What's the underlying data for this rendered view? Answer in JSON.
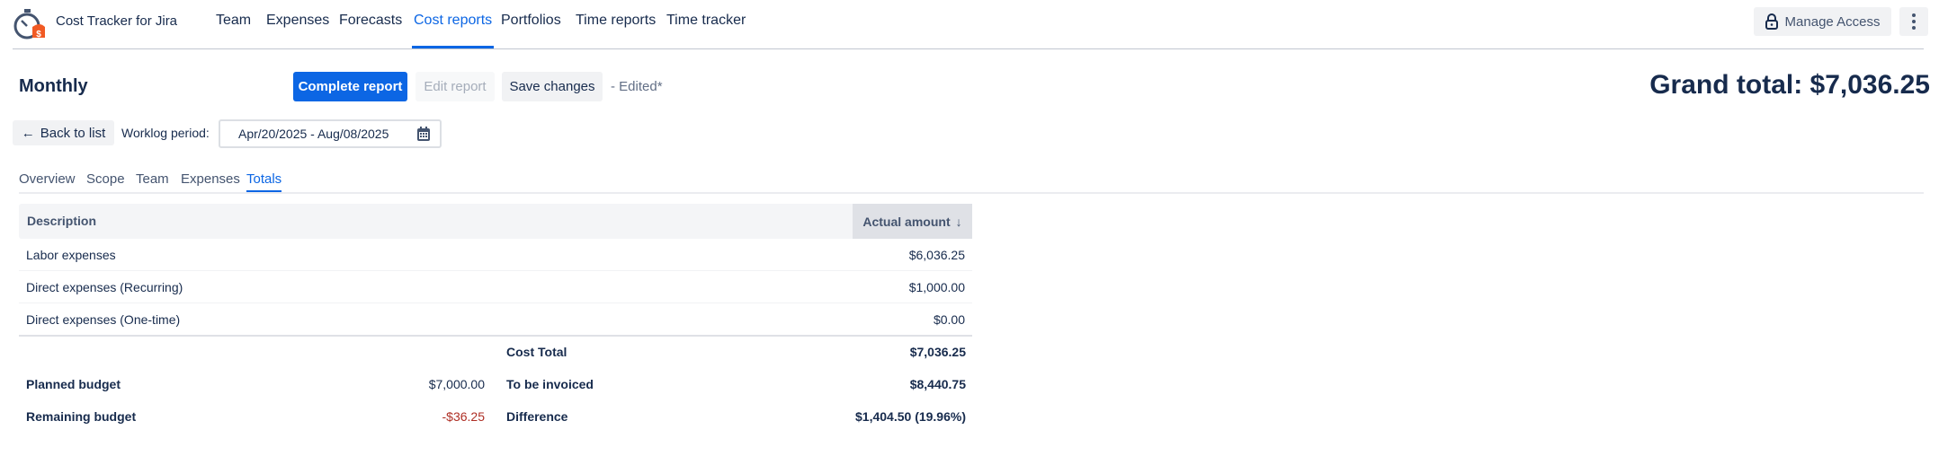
{
  "app": {
    "name": "Cost Tracker for Jira"
  },
  "nav": [
    {
      "label": "Team"
    },
    {
      "label": "Expenses"
    },
    {
      "label": "Forecasts"
    },
    {
      "label": "Cost reports",
      "active": true
    },
    {
      "label": "Portfolios"
    },
    {
      "label": "Time reports"
    },
    {
      "label": "Time tracker"
    }
  ],
  "header": {
    "manage_access": "Manage Access"
  },
  "report": {
    "title": "Monthly",
    "complete": "Complete report",
    "edit": "Edit report",
    "save": "Save changes",
    "edited": "- Edited*",
    "grand_total": "Grand total: $7,036.25"
  },
  "filters": {
    "back": "Back to list",
    "worklog_label": "Worklog period:",
    "worklog_value": "Apr/20/2025 - Aug/08/2025"
  },
  "tabs": [
    {
      "label": "Overview"
    },
    {
      "label": "Scope"
    },
    {
      "label": "Team"
    },
    {
      "label": "Expenses"
    },
    {
      "label": "Totals",
      "active": true
    }
  ],
  "table": {
    "headers": {
      "description": "Description",
      "actual": "Actual amount"
    },
    "rows": [
      {
        "description": "Labor expenses",
        "amount": "$6,036.25"
      },
      {
        "description": "Direct expenses (Recurring)",
        "amount": "$1,000.00"
      },
      {
        "description": "Direct expenses (One-time)",
        "amount": "$0.00"
      }
    ]
  },
  "summary": {
    "cost_total_label": "Cost Total",
    "cost_total": "$7,036.25",
    "planned_label": "Planned budget",
    "planned": "$7,000.00",
    "invoiced_label": "To be invoiced",
    "invoiced": "$8,440.75",
    "remaining_label": "Remaining budget",
    "remaining": "-$36.25",
    "difference_label": "Difference",
    "difference": "$1,404.50 (19.96%)"
  },
  "colors": {
    "accent": "#0c66e4",
    "negative": "#ae2e24"
  }
}
